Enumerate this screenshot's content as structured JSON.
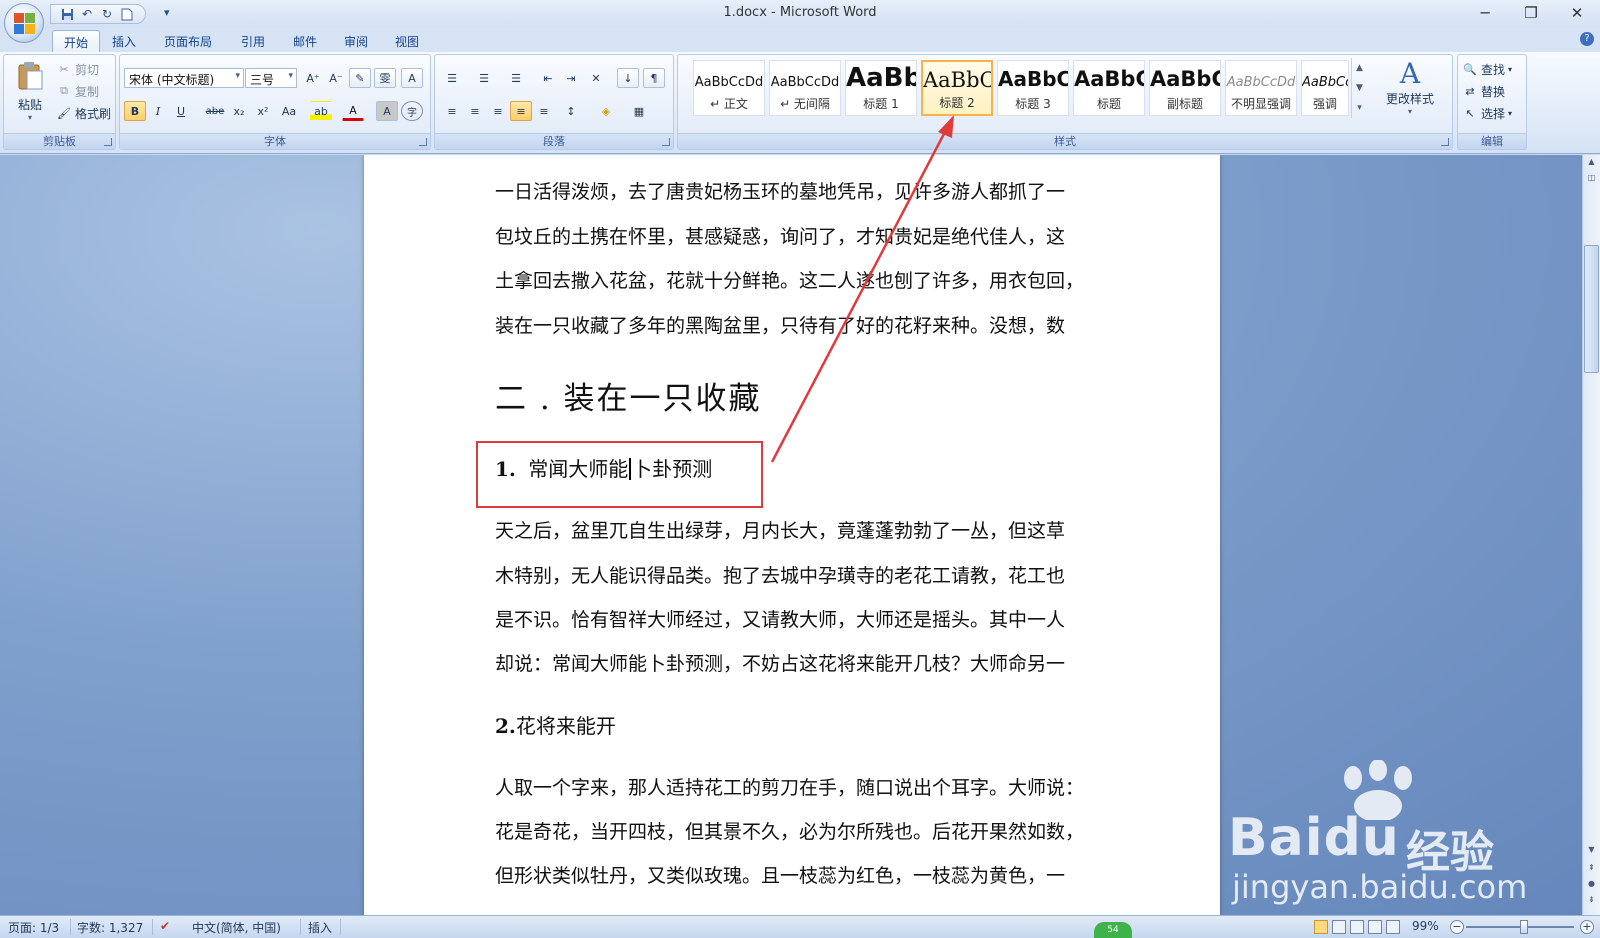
{
  "window": {
    "title": "1.docx - Microsoft Word",
    "minimize": "─",
    "restore": "❐",
    "close": "✕"
  },
  "quick_access": {
    "save_icon": "save-icon",
    "undo_icon": "undo-icon",
    "redo_icon": "redo-icon",
    "new_icon": "new-doc-icon",
    "more": "▾"
  },
  "tabs": [
    {
      "label": "开始",
      "active": true
    },
    {
      "label": "插入"
    },
    {
      "label": "页面布局"
    },
    {
      "label": "引用"
    },
    {
      "label": "邮件"
    },
    {
      "label": "审阅"
    },
    {
      "label": "视图"
    }
  ],
  "help_label": "?",
  "clipboard": {
    "group_label": "剪贴板",
    "paste": "粘贴",
    "cut": "剪切",
    "copy": "复制",
    "format_painter": "格式刷"
  },
  "font": {
    "group_label": "字体",
    "font_name": "宋体 (中文标题)",
    "font_size": "三号",
    "grow": "A⁺",
    "shrink": "A⁻",
    "clear": "✎",
    "phonetic": "雯",
    "border_char": "A",
    "bold": "B",
    "italic": "I",
    "underline": "U",
    "strike": "abe",
    "subscript": "x₂",
    "superscript": "x²",
    "case": "Aa",
    "highlight": "ab",
    "font_color": "A",
    "shade": "A",
    "enclose": "字"
  },
  "paragraph": {
    "group_label": "段落",
    "bullets": "☰",
    "numbering": "☰",
    "multilevel": "☰",
    "decrease_indent": "⇤",
    "increase_indent": "⇥",
    "chinese_layout": "✕",
    "sort": "↓",
    "show_marks": "¶",
    "align_left": "≡",
    "align_center": "≡",
    "align_right": "≡",
    "justify": "≡",
    "distribute": "≡",
    "line_spacing": "↕",
    "shading": "◈",
    "borders": "▦"
  },
  "styles": {
    "group_label": "样式",
    "items": [
      {
        "sample": "AaBbCcDd",
        "name": "↵ 正文"
      },
      {
        "sample": "AaBbCcDd",
        "name": "↵ 无间隔"
      },
      {
        "sample": "AaBb",
        "name": "标题 1"
      },
      {
        "sample": "AaBbC",
        "name": "标题 2",
        "selected": true
      },
      {
        "sample": "AaBbC",
        "name": "标题 3"
      },
      {
        "sample": "AaBbC",
        "name": "标题"
      },
      {
        "sample": "AaBbC",
        "name": "副标题"
      },
      {
        "sample": "AaBbCcDd",
        "name": "不明显强调"
      },
      {
        "sample": "AaBbCcDd",
        "name": "强调"
      }
    ],
    "change_styles": "更改样式"
  },
  "editing": {
    "group_label": "编辑",
    "find": "查找",
    "replace": "替换",
    "select": "选择"
  },
  "document": {
    "lines_top": [
      "一日活得泼烦，去了唐贵妃杨玉环的墓地凭吊，见许多游人都抓了一",
      "包坟丘的土携在怀里，甚感疑惑，询问了，才知贵妃是绝代佳人，这",
      "土拿回去撒入花盆，花就十分鲜艳。这二人遂也刨了许多，用衣包回，",
      "装在一只收藏了多年的黑陶盆里，只待有了好的花籽来种。没想，数"
    ],
    "heading1": "二 . 装在一只收藏",
    "heading2a_num": "1.",
    "heading2a_text_before": "常闻大师能",
    "heading2a_text_after": "卜卦预测",
    "lines_mid": [
      "天之后，盆里兀自生出绿芽，月内长大，竟蓬蓬勃勃了一丛，但这草",
      "木特别，无人能识得品类。抱了去城中孕璜寺的老花工请教，花工也",
      "是不识。恰有智祥大师经过，又请教大师，大师还是摇头。其中一人",
      "却说：常闻大师能卜卦预测，不妨占这花将来能开几枝？大师命另一"
    ],
    "heading2b_num": "2.",
    "heading2b_text": "花将来能开",
    "lines_bottom": [
      "人取一个字来，那人适持花工的剪刀在手，随口说出个耳字。大师说：",
      "花是奇花，当开四枝，但其景不久，必为尔所残也。后花开果然如数，",
      "但形状类似牡丹，又类似玫瑰。且一枝蕊为红色，一枝蕊为黄色，一"
    ]
  },
  "status": {
    "page": "页面: 1/3",
    "words": "字数: 1,327",
    "language": "中文(简体, 中国)",
    "mode": "插入",
    "zoom": "99%",
    "page_badge": "54"
  },
  "watermark": {
    "logo": "Bai",
    "logo_du": "du",
    "cn": "经验",
    "url": "jingyan.baidu.com"
  },
  "colors": {
    "annotation_red": "#e03b3b",
    "selected_style": "#f3b44a",
    "ribbon_text": "#15428b"
  }
}
